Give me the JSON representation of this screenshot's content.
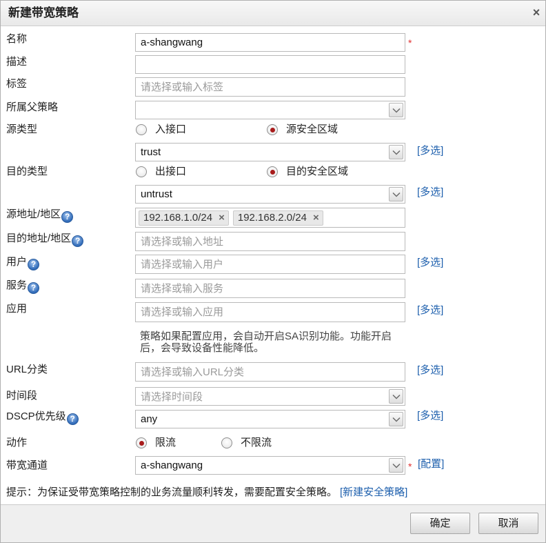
{
  "dialog": {
    "title": "新建带宽策略"
  },
  "icons": {
    "close": {
      "name": "close-icon",
      "glyph": "×"
    },
    "help": {
      "name": "help-icon",
      "glyph": "?"
    },
    "tag_remove": {
      "name": "tag-remove-icon",
      "glyph": "×"
    },
    "dropdown": {
      "name": "chevron-down-icon"
    }
  },
  "form": {
    "name": {
      "label": "名称",
      "value": "a-shangwang",
      "required_mark": "*"
    },
    "description": {
      "label": "描述",
      "value": ""
    },
    "tags": {
      "label": "标签",
      "placeholder": "请选择或输入标签"
    },
    "parent_policy": {
      "label": "所属父策略",
      "value": ""
    },
    "source_type": {
      "label": "源类型",
      "options": [
        {
          "label": "入接口",
          "checked": false
        },
        {
          "label": "源安全区域",
          "checked": true
        }
      ]
    },
    "source_zone": {
      "value": "trust",
      "multi_select_link": "[多选]"
    },
    "destination_type": {
      "label": "目的类型",
      "options": [
        {
          "label": "出接口",
          "checked": false
        },
        {
          "label": "目的安全区域",
          "checked": true
        }
      ]
    },
    "destination_zone": {
      "value": "untrust",
      "multi_select_link": "[多选]"
    },
    "source_address": {
      "label": "源地址/地区",
      "tags": [
        "192.168.1.0/24",
        "192.168.2.0/24"
      ]
    },
    "destination_address": {
      "label": "目的地址/地区",
      "placeholder": "请选择或输入地址"
    },
    "user": {
      "label": "用户",
      "placeholder": "请选择或输入用户",
      "multi_select_link": "[多选]"
    },
    "service": {
      "label": "服务",
      "placeholder": "请选择或输入服务"
    },
    "application": {
      "label": "应用",
      "placeholder": "请选择或输入应用",
      "multi_select_link": "[多选]",
      "hint_lines": [
        "策略如果配置应用，会自动开启SA识别功能。功能开启",
        "后，会导致设备性能降低。"
      ]
    },
    "url_category": {
      "label": "URL分类",
      "placeholder": "请选择或输入URL分类",
      "multi_select_link": "[多选]"
    },
    "time_range": {
      "label": "时间段",
      "placeholder": "请选择时间段"
    },
    "dscp_priority": {
      "label": "DSCP优先级",
      "value": "any",
      "multi_select_link": "[多选]"
    },
    "action": {
      "label": "动作",
      "options": [
        {
          "label": "限流",
          "checked": true
        },
        {
          "label": "不限流",
          "checked": false
        }
      ]
    },
    "bandwidth_channel": {
      "label": "带宽通道",
      "value": "a-shangwang",
      "required_mark": "*",
      "config_link": "[配置]"
    }
  },
  "notice": {
    "text": "提示：为保证受带宽策略控制的业务流量顺利转发，需要配置安全策略。",
    "link": "[新建安全策略]"
  },
  "footer": {
    "ok_label": "确定",
    "cancel_label": "取消"
  },
  "colors": {
    "link": "#1d5fad",
    "required": "#e03030",
    "radio_checked": "#a81c1c",
    "help": "#2f6ab8",
    "placeholder": "#9a9a9a",
    "header_bg": "#e9e9e9",
    "footer_bg": "#efefef"
  }
}
